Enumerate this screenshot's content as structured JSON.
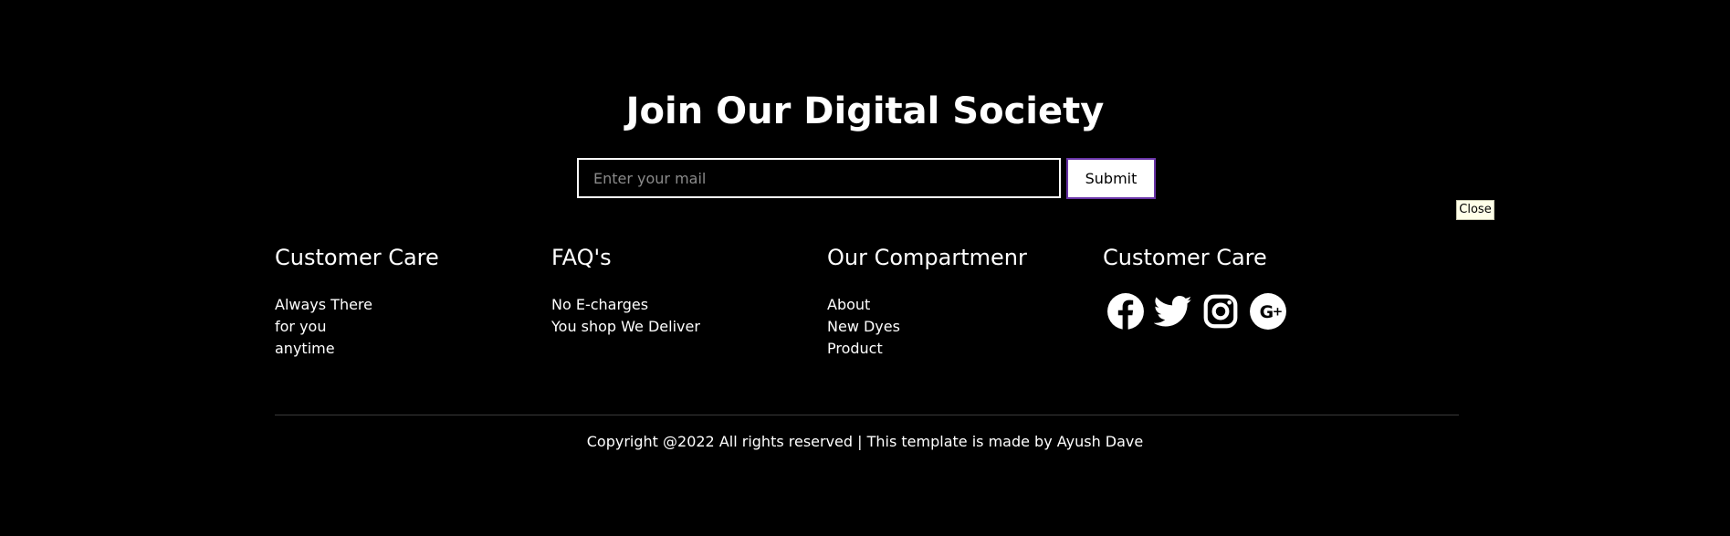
{
  "newsletter": {
    "title": "Join Our Digital Society",
    "email_placeholder": "Enter your mail",
    "submit_label": "Submit"
  },
  "close_label": "Close",
  "footer": {
    "columns": [
      {
        "heading": "Customer Care",
        "lines": [
          "Always There",
          "for you",
          "anytime"
        ]
      },
      {
        "heading": "FAQ's",
        "lines": [
          "No E-charges",
          "You shop We Deliver"
        ]
      },
      {
        "heading": "Our Compartmenr",
        "lines": [
          "About",
          "New Dyes",
          "Product"
        ]
      },
      {
        "heading": "Customer Care",
        "social": [
          "facebook-icon",
          "twitter-icon",
          "instagram-icon",
          "google-plus-icon"
        ]
      }
    ]
  },
  "copyright": "Copyright @2022 All rights reserved | This template is made by Ayush Dave",
  "colors": {
    "background": "#000000",
    "text": "#ffffff",
    "submit_border": "#6a35a8",
    "divider": "#3a3a3a",
    "close_background": "#ffffe8"
  }
}
